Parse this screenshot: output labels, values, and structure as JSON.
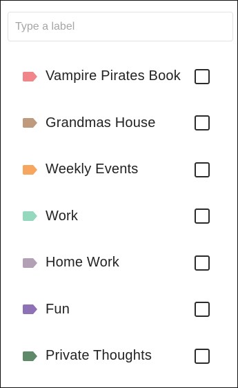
{
  "search": {
    "placeholder": "Type a label",
    "value": ""
  },
  "labels": [
    {
      "name": "Vampire Pirates Book",
      "color": "#f0868a",
      "checked": false
    },
    {
      "name": "Grandmas House",
      "color": "#c09a7d",
      "checked": false
    },
    {
      "name": "Weekly Events",
      "color": "#f6a65e",
      "checked": false
    },
    {
      "name": "Work",
      "color": "#94d8bd",
      "checked": false
    },
    {
      "name": "Home Work",
      "color": "#b3a0b7",
      "checked": false
    },
    {
      "name": "Fun",
      "color": "#8e72b6",
      "checked": false
    },
    {
      "name": "Private Thoughts",
      "color": "#5f8a69",
      "checked": false
    }
  ]
}
